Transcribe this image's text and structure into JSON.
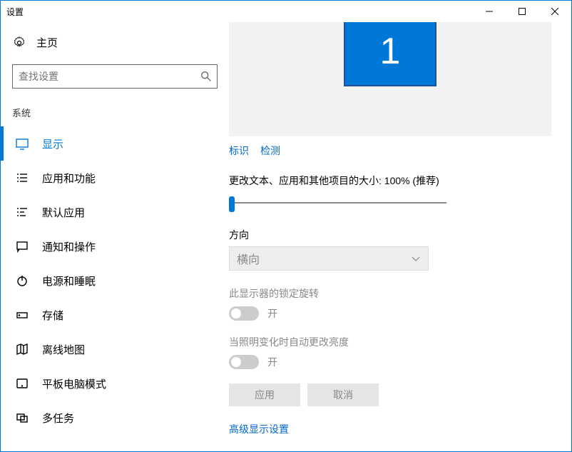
{
  "window": {
    "title": "设置"
  },
  "sidebar": {
    "home": "主页",
    "search_placeholder": "查找设置",
    "section": "系统",
    "items": [
      {
        "label": "显示"
      },
      {
        "label": "应用和功能"
      },
      {
        "label": "默认应用"
      },
      {
        "label": "通知和操作"
      },
      {
        "label": "电源和睡眠"
      },
      {
        "label": "存储"
      },
      {
        "label": "离线地图"
      },
      {
        "label": "平板电脑模式"
      },
      {
        "label": "多任务"
      }
    ]
  },
  "main": {
    "monitor_number": "1",
    "identify": "标识",
    "detect": "检测",
    "scale_label": "更改文本、应用和其他项目的大小: 100% (推荐)",
    "orientation_title": "方向",
    "orientation_value": "横向",
    "lock_rotation_label": "此显示器的锁定旋转",
    "lock_rotation_state": "开",
    "auto_brightness_label": "当照明变化时自动更改亮度",
    "auto_brightness_state": "开",
    "apply": "应用",
    "cancel": "取消",
    "advanced": "高级显示设置"
  }
}
